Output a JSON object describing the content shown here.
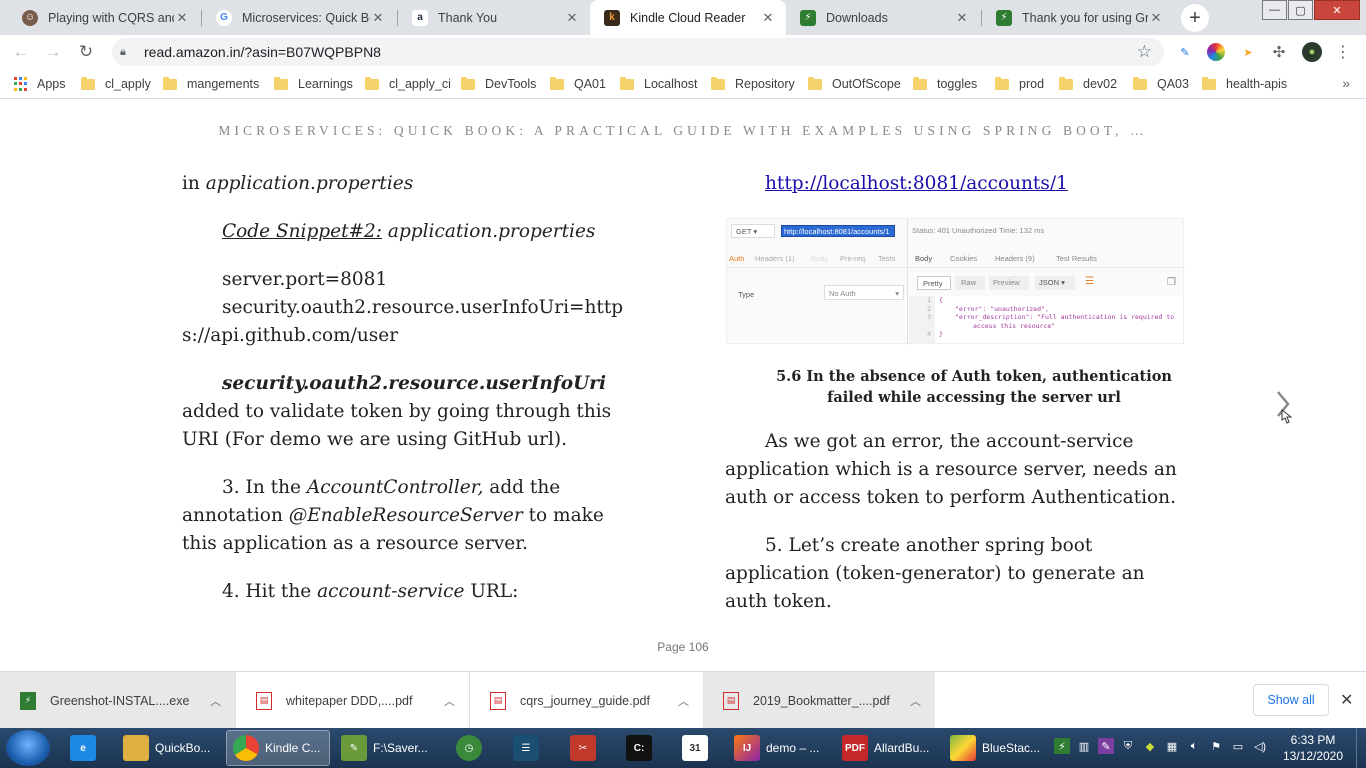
{
  "browser": {
    "tabs": [
      {
        "title": "Playing with CQRS and E",
        "icon": "avatar-favicon",
        "color": "#7a5c4a"
      },
      {
        "title": "Microservices: Quick Boo",
        "icon": "google-favicon",
        "color": "#4285f4"
      },
      {
        "title": "Thank You",
        "icon": "amazon-favicon",
        "color": "#232f3e"
      },
      {
        "title": "Kindle Cloud Reader",
        "icon": "kindle-favicon",
        "color": "#f0a030"
      },
      {
        "title": "Downloads",
        "icon": "greenshot-favicon",
        "color": "#2e7d32"
      },
      {
        "title": "Thank you for using Gre",
        "icon": "greenshot-favicon",
        "color": "#2e7d32"
      }
    ],
    "active_tab_index": 3,
    "new_tab_label": "+",
    "url": "read.amazon.in/?asin=B07WQPBPN8",
    "bookmarks_apps_label": "Apps",
    "bookmarks": [
      "cl_apply",
      "mangements",
      "Learnings",
      "cl_apply_ci",
      "DevTools",
      "QA01",
      "Localhost",
      "Repository",
      "OutOfScope",
      "toggles",
      "prod",
      "dev02",
      "QA03",
      "health-apis"
    ],
    "bookmarks_more": "»"
  },
  "reader": {
    "book_title": "MICROSERVICES: QUICK BOOK: A PRACTICAL GUIDE WITH EXAMPLES USING SPRING BOOT, …",
    "left": {
      "l1a": "in ",
      "l1b": "application.properties",
      "snippet_label": "Code Snippet#2:",
      "snippet_file": " application.properties",
      "code1": "server.port=8081",
      "code2": "security.oauth2.resource.userInfoUri=https://api.github.com/user",
      "prop_name": "security.oauth2.resource.userInfoUri",
      "prop_desc": " added to validate token by going through this URI (For demo we are using GitHub url).",
      "step3a": "3. In the ",
      "step3b": "AccountController,",
      "step3c": " add the annotation ",
      "step3d": "@EnableResourceServer",
      "step3e": " to make this application as a resource server.",
      "step4a": "4. Hit the ",
      "step4b": "account-service",
      "step4c": " URL:"
    },
    "right": {
      "link": "http://localhost:8081/accounts/1",
      "caption": "5.6 In the absence of Auth token, authentication failed while accessing the server url",
      "para1": "As we got an error, the account-service application which is a resource server, needs an auth or access token to perform Authentication.",
      "para2": "5. Let’s create another spring boot application (token-generator) to generate an auth token."
    },
    "postman": {
      "method": "GET",
      "url": "http://localhost:8081/accounts/1",
      "status": "Status: 401 Unauthorized",
      "time": "Time: 132 ms",
      "left_tabs": [
        "Auth",
        "Headers (1)",
        "Body",
        "Pre-req.",
        "Tests"
      ],
      "right_tabs": [
        "Body",
        "Cookies",
        "Headers (9)",
        "Test Results"
      ],
      "view_btns": [
        "Pretty",
        "Raw",
        "Preview"
      ],
      "format": "JSON",
      "type_label": "Type",
      "type_value": "No Auth",
      "code": [
        "{",
        "\"error\": \"unauthorized\",",
        "\"error_description\": \"Full authentication is required to",
        "access this resource\"",
        "}"
      ],
      "line_nums": [
        "1",
        "2",
        "3",
        "",
        "4"
      ]
    },
    "page_label": "Page 106"
  },
  "downloads": {
    "items": [
      {
        "name": "Greenshot-INSTAL....exe",
        "icon": "exe-icon",
        "color": "#2e7d32"
      },
      {
        "name": "whitepaper DDD,....pdf",
        "icon": "pdf-icon",
        "color": "#d32f2f"
      },
      {
        "name": "cqrs_journey_guide.pdf",
        "icon": "pdf-icon",
        "color": "#d32f2f"
      },
      {
        "name": "2019_Bookmatter_....pdf",
        "icon": "pdf-icon",
        "color": "#d32f2f"
      }
    ],
    "show_all": "Show all"
  },
  "taskbar": {
    "items": [
      {
        "label": "",
        "icon": "ie-icon",
        "color": "#1e88e5"
      },
      {
        "label": "QuickBo...",
        "icon": "folder-icon",
        "color": "#e0b040"
      },
      {
        "label": "Kindle C...",
        "icon": "chrome-icon",
        "color": "#34a853"
      },
      {
        "label": "F:\\Saver...",
        "icon": "notepad-icon",
        "color": "#6a9a3a"
      },
      {
        "label": "",
        "icon": "clock-icon",
        "color": "#3b8a3b"
      },
      {
        "label": "",
        "icon": "terminal-icon",
        "color": "#1b4f72"
      },
      {
        "label": "",
        "icon": "snipping-icon",
        "color": "#c0392b"
      },
      {
        "label": "",
        "icon": "cmd-icon",
        "color": "#111111"
      },
      {
        "label": "",
        "icon": "calendar-icon",
        "color": "#ffffff"
      },
      {
        "label": "demo – ...",
        "icon": "intellij-icon",
        "color": "#8e24aa"
      },
      {
        "label": "AllardBu...",
        "icon": "pdf-icon",
        "color": "#c62828"
      },
      {
        "label": "BlueStac...",
        "icon": "bluestacks-icon",
        "color": "#7cb342"
      }
    ],
    "time": "6:33 PM",
    "date": "13/12/2020"
  }
}
